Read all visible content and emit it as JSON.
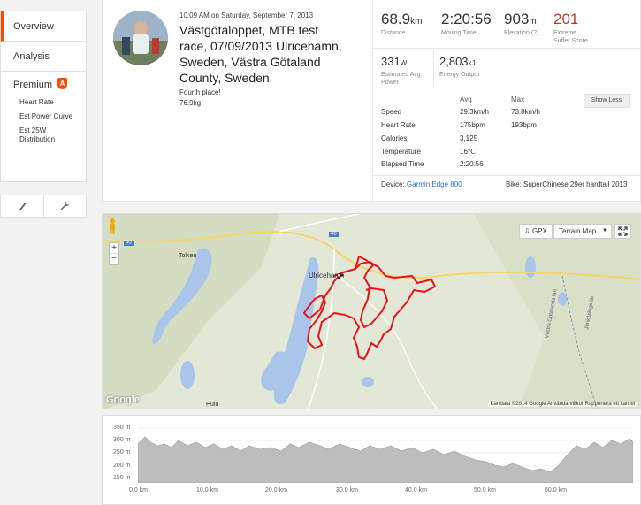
{
  "sidebar": {
    "overview": "Overview",
    "analysis": "Analysis",
    "premium": "Premium",
    "premium_badge": "A",
    "premium_items": [
      "Heart Rate",
      "Est Power Curve",
      "Est 25W Distribution"
    ],
    "tools": [
      "pencil-icon",
      "wrench-icon"
    ]
  },
  "activity": {
    "date": "10:09 AM on Saturday, September 7, 2013",
    "title": "Västgötaloppet, MTB test race, 07/09/2013 Ulricehamn, Sweden, Västra Götaland County, Sweden",
    "title_lines": [
      "Västgötaloppet, MTB test",
      "race, 07/09/2013 Ulricehamn,",
      "Sweden, Västra Götaland",
      "County, Sweden"
    ],
    "description": [
      "Fourth place!",
      "76.9kg"
    ]
  },
  "stats": {
    "distance": {
      "value": "68.9",
      "unit": "km",
      "label": "Distance"
    },
    "moving_time": {
      "value": "2:20:56",
      "label": "Moving Time"
    },
    "elevation": {
      "value": "903",
      "unit": "m",
      "label": "Elevation (?)"
    },
    "suffer": {
      "value": "201",
      "label_1": "Extreme",
      "label_2": "Suffer Score"
    },
    "power": {
      "value": "331",
      "unit": "W",
      "label_1": "Estimated Avg",
      "label_2": "Power"
    },
    "energy": {
      "value": "2,803",
      "unit": "kJ",
      "label": "Energy Output"
    }
  },
  "table": {
    "headers": {
      "avg": "Avg",
      "max": "Max"
    },
    "rows": [
      {
        "label": "Speed",
        "avg": "29.3km/h",
        "max": "73.8km/h"
      },
      {
        "label": "Heart Rate",
        "avg": "175bpm",
        "max": "193bpm"
      },
      {
        "label": "Calories",
        "avg": "3,125",
        "max": ""
      },
      {
        "label": "Temperature",
        "avg": "16℃",
        "max": ""
      },
      {
        "label": "Elapsed Time",
        "avg": "2:20:56",
        "max": ""
      }
    ],
    "show_less": "Show Less"
  },
  "footer": {
    "device_label": "Device:",
    "device": "Garmin Edge 800",
    "bike": "Bike: SuperChinese 29er hardtail 2013"
  },
  "map": {
    "gpx_label": "GPX",
    "map_type": "Terrain Map",
    "attribution": "Kartdata ©2014 Google   Användarvillkor   Rapportera ett kartfel",
    "google": "Google",
    "place_ulricehamn": "Ulricehamn",
    "place_tolken": "Tolken",
    "place_hulu": "Hulu",
    "road_40": "40",
    "region_1": "Västra Götalands län",
    "region_2": "Jönköpings län",
    "route_color": "#e8121b"
  },
  "elevation": {
    "y_ticks": [
      "350 m",
      "300 m",
      "250 m",
      "200 m",
      "150 m"
    ],
    "x_ticks": [
      "0.0 km",
      "10.0 km",
      "20.0 km",
      "30.0 km",
      "40.0 km",
      "50.0 km",
      "60.0 km"
    ]
  },
  "colors": {
    "accent": "#fc4c02",
    "link": "#2b72c4",
    "suffer": "#c0392b"
  }
}
